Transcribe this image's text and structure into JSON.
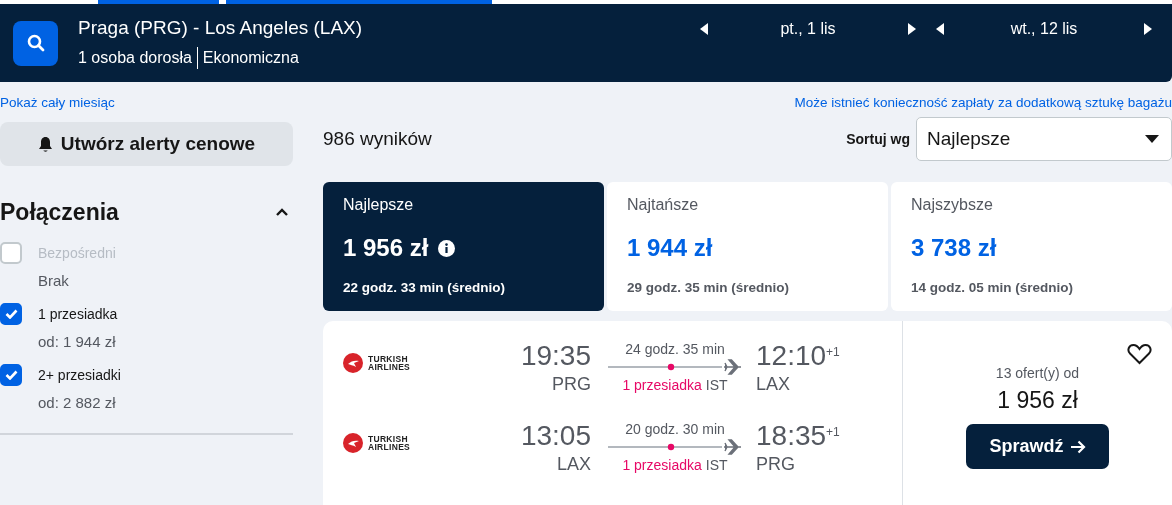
{
  "header": {
    "route": "Praga (PRG) - Los Angeles (LAX)",
    "passengers": "1 osoba dorosła",
    "cabin": "Ekonomiczna",
    "dates": [
      "pt., 1 lis",
      "wt., 12 lis"
    ]
  },
  "links": {
    "month": "Pokaż cały miesiąc",
    "baggage_notice": "Może istnieć konieczność zapłaty za dodatkową sztukę bagażu"
  },
  "sidebar": {
    "alert_button": "Utwórz alerty cenowe",
    "filter": {
      "title": "Połączenia",
      "expanded": true,
      "options": [
        {
          "label": "Bezpośredni",
          "price": "Brak",
          "checked": false,
          "disabled": true
        },
        {
          "label": "1 przesiadka",
          "price": "od: 1 944 zł",
          "checked": true,
          "disabled": false
        },
        {
          "label": "2+ przesiadki",
          "price": "od: 2 882 zł",
          "checked": true,
          "disabled": false
        }
      ]
    }
  },
  "results": {
    "count": "986 wyników",
    "sort_label": "Sortuj wg",
    "sort_value": "Najlepsze",
    "tabs": [
      {
        "label": "Najlepsze",
        "price": "1 956 zł",
        "duration": "22 godz. 33 min (średnio)",
        "selected": true,
        "info": true
      },
      {
        "label": "Najtańsze",
        "price": "1 944 zł",
        "duration": "29 godz. 35 min (średnio)",
        "selected": false,
        "info": false
      },
      {
        "label": "Najszybsze",
        "price": "3 738 zł",
        "duration": "14 godz. 05 min (średnio)",
        "selected": false,
        "info": false
      }
    ]
  },
  "flights": [
    {
      "favorite": false,
      "offers": "13 ofert(y) od",
      "price": "1 956 zł",
      "button": "Sprawdź",
      "legs": [
        {
          "airline": "TURKISH AIRLINES",
          "depart_time": "19:35",
          "depart_code": "PRG",
          "duration": "24 godz. 35 min",
          "stops": "1 przesiadka",
          "via": "IST",
          "arrive_time": "12:10",
          "day_offset": "+1",
          "arrive_code": "LAX"
        },
        {
          "airline": "TURKISH AIRLINES",
          "depart_time": "13:05",
          "depart_code": "LAX",
          "duration": "20 godz. 30 min",
          "stops": "1 przesiadka",
          "via": "IST",
          "arrive_time": "18:35",
          "day_offset": "+1",
          "arrive_code": "PRG"
        }
      ]
    }
  ]
}
